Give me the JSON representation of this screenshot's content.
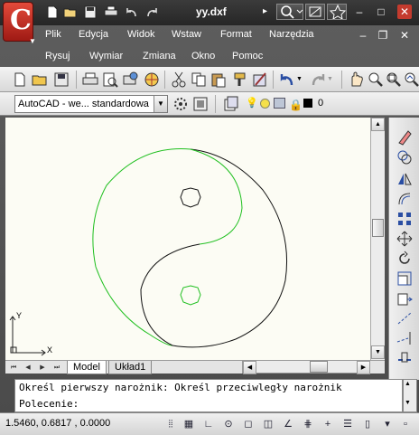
{
  "window": {
    "title": "yy.dxf"
  },
  "menu": {
    "row1": [
      {
        "label": "Plik"
      },
      {
        "label": "Edycja"
      },
      {
        "label": "Widok"
      },
      {
        "label": "Wstaw"
      },
      {
        "label": "Format"
      },
      {
        "label": "Narzędzia"
      }
    ],
    "row2": [
      {
        "label": "Rysuj"
      },
      {
        "label": "Wymiar"
      },
      {
        "label": "Zmiana"
      },
      {
        "label": "Okno"
      },
      {
        "label": "Pomoc"
      }
    ]
  },
  "style_toolbar": {
    "text_style": "AutoCAD - we... standardowa",
    "layer_value": "0"
  },
  "layout_tabs": {
    "model": "Model",
    "layout1": "Układ1"
  },
  "ucs": {
    "x_label": "X",
    "y_label": "Y"
  },
  "command": {
    "history_line": "Określ pierwszy narożnik: Określ przeciwległy narożnik",
    "prompt": "Polecenie:"
  },
  "status": {
    "coordinates": "1.5460, 0.6817 , 0.0000"
  },
  "colors": {
    "drawing_background": "#fcfcf4",
    "green_stroke": "#1fbf1f",
    "black_stroke": "#111111",
    "brand_red": "#c8281e"
  }
}
